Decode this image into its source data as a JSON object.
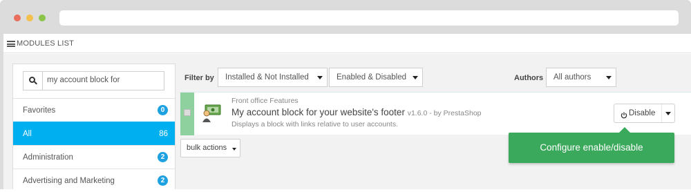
{
  "panel": {
    "title": "MODULES LIST"
  },
  "search": {
    "value": "my account block for"
  },
  "categories": [
    {
      "label": "Favorites",
      "count": "0"
    },
    {
      "label": "All",
      "count": "86"
    },
    {
      "label": "Administration",
      "count": "2"
    },
    {
      "label": "Advertising and Marketing",
      "count": "2"
    }
  ],
  "filters": {
    "label": "Filter by",
    "install_status": "Installed & Not Installed",
    "enable_status": "Enabled & Disabled",
    "authors_label": "Authors",
    "authors_value": "All authors"
  },
  "module": {
    "category": "Front office Features",
    "title": "My account block for your website's footer",
    "version": "v1.6.0 - by PrestaShop",
    "description": "Displays a block with links relative to user accounts.",
    "action_label": "Disable"
  },
  "bulk": {
    "label": "bulk actions"
  },
  "tooltip": {
    "text": "Configure enable/disable"
  },
  "colors": {
    "accent_blue": "#00aff0",
    "badge_blue": "#1ea1e0",
    "row_check_green": "#8ed19f",
    "tooltip_green": "#3aa95c"
  }
}
